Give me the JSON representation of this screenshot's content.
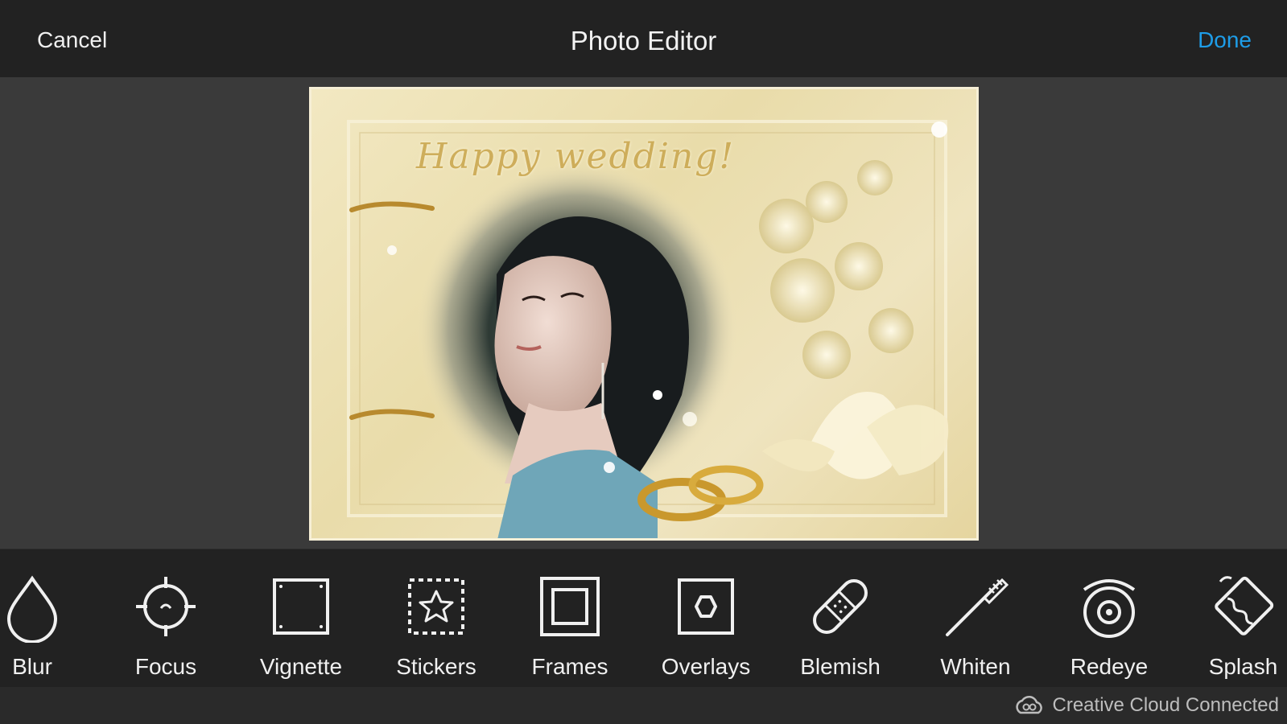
{
  "header": {
    "cancel_label": "Cancel",
    "title": "Photo Editor",
    "done_label": "Done"
  },
  "photo": {
    "caption": "Happy wedding!"
  },
  "tools": [
    {
      "label": "Blur",
      "icon": "blur-drop-icon"
    },
    {
      "label": "Focus",
      "icon": "focus-crosshair-icon"
    },
    {
      "label": "Vignette",
      "icon": "vignette-icon"
    },
    {
      "label": "Stickers",
      "icon": "stickers-star-icon"
    },
    {
      "label": "Frames",
      "icon": "frames-icon"
    },
    {
      "label": "Overlays",
      "icon": "overlays-hexagon-icon"
    },
    {
      "label": "Blemish",
      "icon": "blemish-bandage-icon"
    },
    {
      "label": "Whiten",
      "icon": "whiten-toothbrush-icon"
    },
    {
      "label": "Redeye",
      "icon": "redeye-icon"
    },
    {
      "label": "Splash",
      "icon": "splash-bucket-icon"
    }
  ],
  "status": {
    "cc_label": "Creative Cloud Connected",
    "cc_icon": "creative-cloud-icon"
  },
  "colors": {
    "accent": "#1e9de8",
    "topbar": "#222222",
    "background": "#3a3a3a"
  }
}
